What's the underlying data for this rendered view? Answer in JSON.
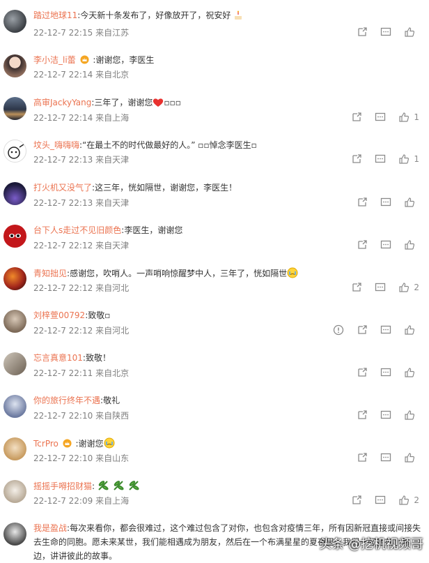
{
  "comments": [
    {
      "user": "踏过地球11",
      "sep": ":",
      "text": "今天新十条发布了，好像放开了，祝安好",
      "time": "22-12-7 22:15",
      "loc": "来自江苏",
      "likes": ""
    },
    {
      "user": "李小洁_li蕾",
      "sep": " :",
      "text": "谢谢您，李医生",
      "time": "22-12-7 22:14",
      "loc": "来自北京",
      "likes": ""
    },
    {
      "user": "高审JackyYang",
      "sep": ":",
      "text": "三年了，谢谢您",
      "text_tail": "▫▫▫",
      "time": "22-12-7 22:14",
      "loc": "来自上海",
      "likes": "1"
    },
    {
      "user": "坟头_嗨嗨嗨",
      "sep": ":",
      "text": "“在最土不的时代做最好的人。”  ▫▫悼念李医生▫",
      "time": "22-12-7 22:13",
      "loc": "来自天津",
      "likes": "1"
    },
    {
      "user": "打火机又没气了",
      "sep": ":",
      "text": "这三年，恍如隔世，谢谢您，李医生！",
      "time": "22-12-7 22:13",
      "loc": "来自天津",
      "likes": ""
    },
    {
      "user": "台下人s走过不见旧颜色",
      "sep": ":",
      "text": "李医生，谢谢您",
      "time": "22-12-7 22:12",
      "loc": "来自天津",
      "likes": ""
    },
    {
      "user": "青知拙见",
      "sep": ":",
      "text": "感谢您，吹哨人。一声哨响惊醒梦中人，三年了，恍如隔世",
      "time": "22-12-7 22:12",
      "loc": "来自河北",
      "likes": "2"
    },
    {
      "user": "刘梓萱00792",
      "sep": ":",
      "text": "致敬▫",
      "time": "22-12-7 22:12",
      "loc": "来自河北",
      "likes": ""
    },
    {
      "user": "忘言真意101",
      "sep": ":",
      "text": "致敬！",
      "time": "22-12-7 22:11",
      "loc": "来自北京",
      "likes": ""
    },
    {
      "user": "你的旅行终年不遇",
      "sep": ":",
      "text": "敬礼",
      "time": "22-12-7 22:10",
      "loc": "来自陕西",
      "likes": ""
    },
    {
      "user": "TcrPro",
      "sep": " :",
      "text": "谢谢您",
      "time": "22-12-7 22:10",
      "loc": "来自山东",
      "likes": ""
    },
    {
      "user": "摇摇手嘚招财猫",
      "sep": ":",
      "text": "",
      "time": "22-12-7 22:09",
      "loc": "来自上海",
      "likes": "2"
    },
    {
      "user": "我是盈战",
      "sep": ":",
      "text": "每次来看你，都会很难过，这个难过包含了对你，也包含对疫情三年，所有因新冠直接或间接失去生命的同胞。愿未来某世，我们能相遇成为朋友，然后在一个布满星星的夏夜里，我们一起坐在小河边，讲讲彼此的故事。",
      "time": "",
      "loc": "",
      "likes": ""
    }
  ],
  "watermark": "头条 @挖机视频哥",
  "colors": {
    "username": "#eb7350",
    "meta": "#808080",
    "icon": "#8a8a8a"
  }
}
